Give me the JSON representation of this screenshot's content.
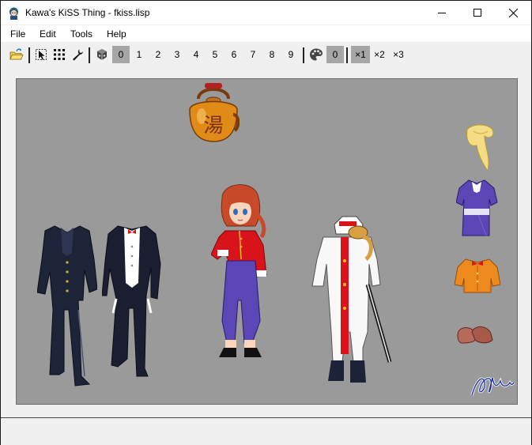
{
  "window": {
    "title": "Kawa's KiSS Thing - fkiss.lisp",
    "app_icon": "kiss-doll-icon",
    "controls": [
      "minimize-icon",
      "maximize-icon",
      "close-icon"
    ]
  },
  "menu": {
    "items": [
      {
        "label": "File"
      },
      {
        "label": "Edit"
      },
      {
        "label": "Tools"
      },
      {
        "label": "Help"
      }
    ]
  },
  "toolbar": {
    "icons": [
      "open-file-icon",
      "select-cursor-icon",
      "grid-icon",
      "wrench-icon",
      "sets-icon",
      "palette-icon"
    ],
    "sets": [
      "0",
      "1",
      "2",
      "3",
      "4",
      "5",
      "6",
      "7",
      "8",
      "9"
    ],
    "selected_set": "0",
    "palette": "0",
    "zoom": [
      "×1",
      "×2",
      "×3"
    ],
    "selected_zoom": "×1"
  },
  "canvas": {
    "background": "#9a9a9a",
    "cels": [
      "kettle-cel",
      "boy-uniform-cel",
      "tuxedo-cel",
      "ranma-doll-cel",
      "white-costume-cel",
      "scarf-cel",
      "purple-dress-cel",
      "orange-jacket-cel",
      "shoes-cel",
      "artist-signature-cel"
    ],
    "kettle_kanji": "湯"
  },
  "colors": {
    "red": "#d8141a",
    "purple": "#5a46b4",
    "navy": "#1c2238",
    "orange": "#e88a10",
    "hair": "#c84a2a"
  }
}
